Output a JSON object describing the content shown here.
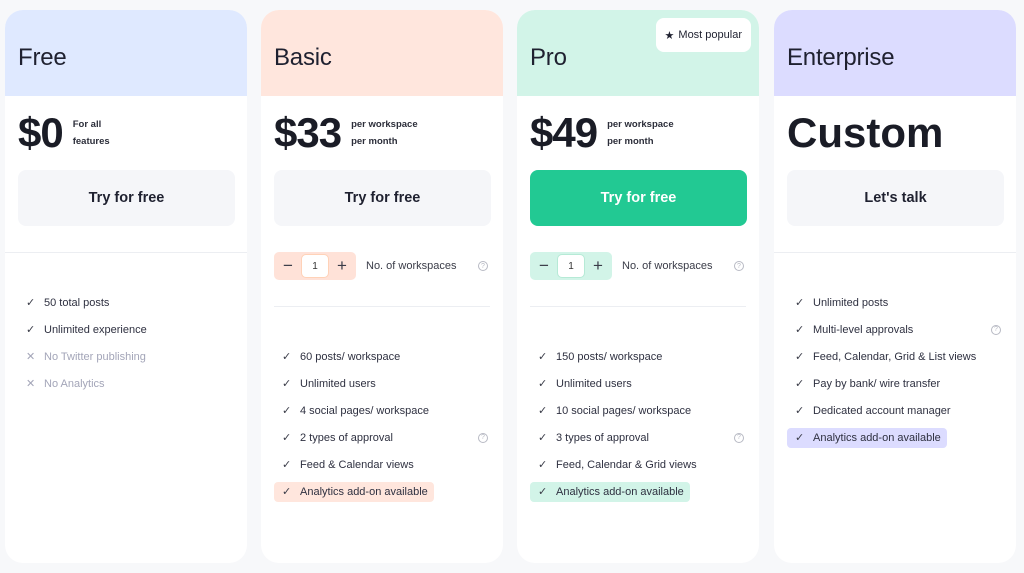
{
  "plans": [
    {
      "name": "Free",
      "price": "$0",
      "price_note": [
        "For all",
        "features"
      ],
      "cta": "Try for free",
      "features": [
        {
          "text": "50 total posts",
          "included": true
        },
        {
          "text": "Unlimited experience",
          "included": true
        },
        {
          "text": "No Twitter publishing",
          "included": false
        },
        {
          "text": "No Analytics",
          "included": false
        }
      ]
    },
    {
      "name": "Basic",
      "price": "$33",
      "price_note": [
        "per workspace",
        "per month"
      ],
      "cta": "Try for free",
      "workspaces": {
        "value": "1",
        "label": "No. of workspaces",
        "minus": "−",
        "plus": "+"
      },
      "features": [
        {
          "text": "60 posts/ workspace",
          "included": true
        },
        {
          "text": "Unlimited users",
          "included": true
        },
        {
          "text": "4 social pages/ workspace",
          "included": true
        },
        {
          "text": "2 types of approval",
          "included": true,
          "help": true
        },
        {
          "text": "Feed & Calendar views",
          "included": true
        },
        {
          "text": "Analytics add-on available",
          "included": true,
          "highlight": true
        }
      ]
    },
    {
      "name": "Pro",
      "badge": "Most popular",
      "price": "$49",
      "price_note": [
        "per workspace",
        "per month"
      ],
      "cta": "Try for free",
      "workspaces": {
        "value": "1",
        "label": "No. of workspaces",
        "minus": "−",
        "plus": "+"
      },
      "features": [
        {
          "text": "150 posts/ workspace",
          "included": true
        },
        {
          "text": "Unlimited users",
          "included": true
        },
        {
          "text": "10 social pages/ workspace",
          "included": true
        },
        {
          "text": "3 types of approval",
          "included": true,
          "help": true
        },
        {
          "text": "Feed, Calendar & Grid views",
          "included": true
        },
        {
          "text": "Analytics add-on available",
          "included": true,
          "highlight": true
        }
      ]
    },
    {
      "name": "Enterprise",
      "price": "Custom",
      "cta": "Let's talk",
      "features": [
        {
          "text": "Unlimited posts",
          "included": true
        },
        {
          "text": "Multi-level approvals",
          "included": true,
          "help": true
        },
        {
          "text": "Feed, Calendar, Grid & List views",
          "included": true
        },
        {
          "text": "Pay by bank/ wire transfer",
          "included": true
        },
        {
          "text": "Dedicated account manager",
          "included": true
        },
        {
          "text": "Analytics add-on available",
          "included": true,
          "highlight": true
        }
      ]
    }
  ],
  "icons": {
    "check": "✓",
    "cross": "✕",
    "star": "★",
    "help": "?"
  },
  "colors": {
    "free_header": "#dfe9ff",
    "basic_header": "#ffe6dd",
    "pro_header": "#d2f4e8",
    "enterprise_header": "#dcdcff",
    "pro_cta": "#22c993",
    "page_bg": "#f7f8fa"
  }
}
